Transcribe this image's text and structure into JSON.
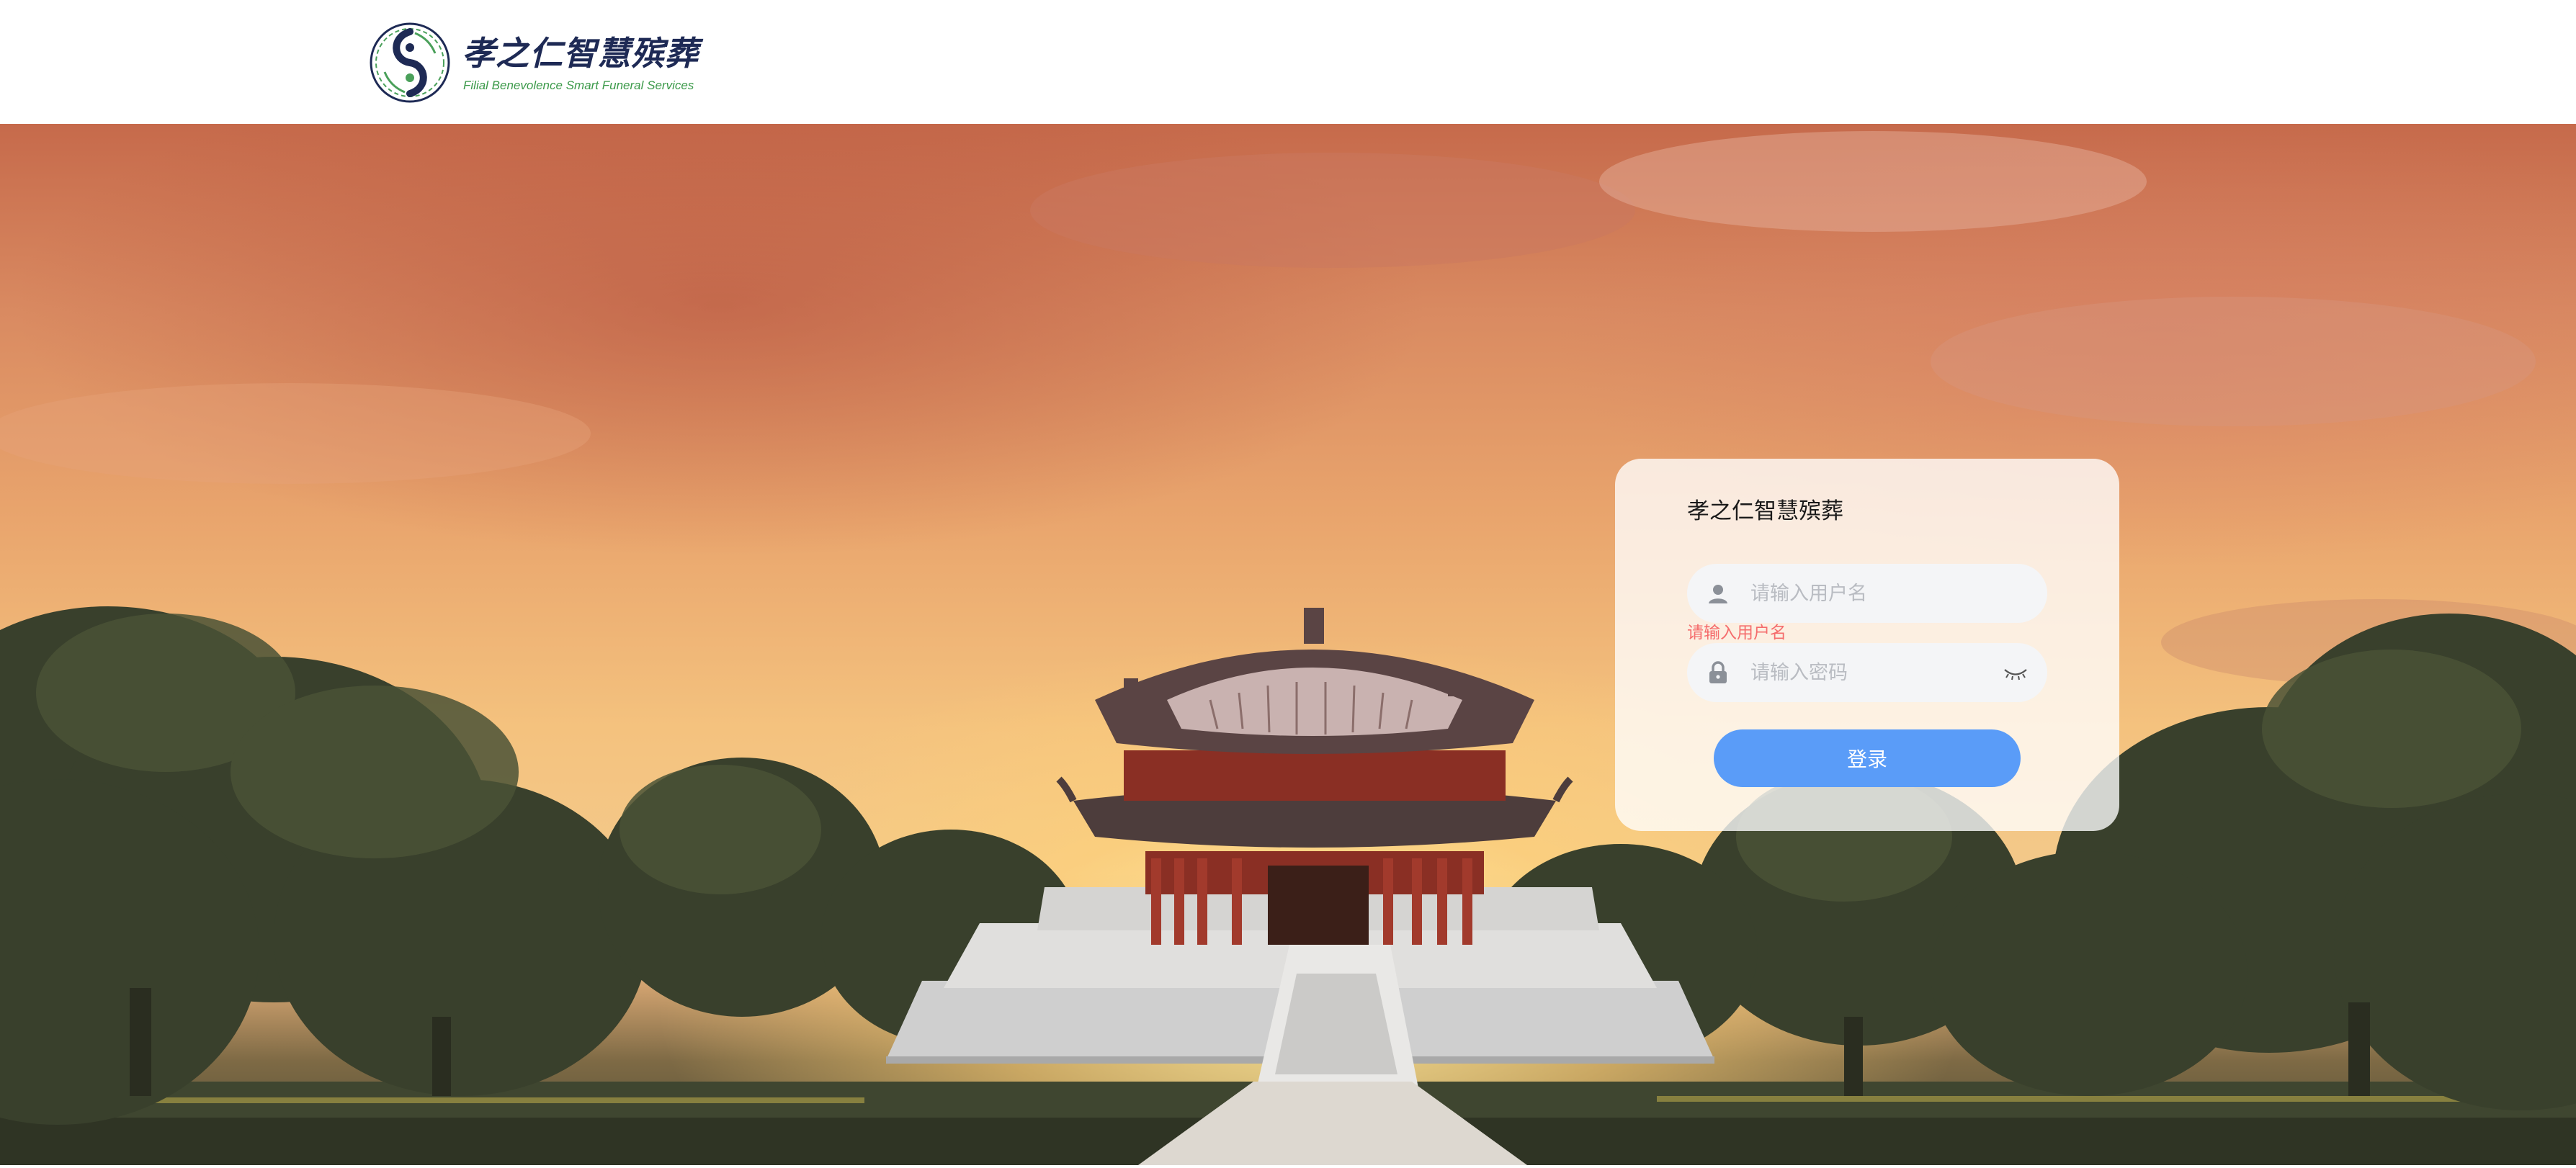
{
  "header": {
    "logo": {
      "title": "孝之仁智慧殡葬",
      "subtitle": "Filial Benevolence Smart Funeral Services",
      "icon": "yin-yang-seal-icon"
    }
  },
  "hero": {
    "background": "sunset-pavilion-scene"
  },
  "login": {
    "title": "孝之仁智慧殡葬",
    "username": {
      "placeholder": "请输入用户名",
      "value": "",
      "icon": "user-icon",
      "error": "请输入用户名"
    },
    "password": {
      "placeholder": "请输入密码",
      "value": "",
      "icon": "lock-icon",
      "toggle_icon": "eye-closed-icon"
    },
    "submit_label": "登录"
  },
  "colors": {
    "primary": "#5a9cf8",
    "error": "#f56c6c",
    "brand_dark": "#1e2a55",
    "brand_green": "#3c9a4a"
  }
}
